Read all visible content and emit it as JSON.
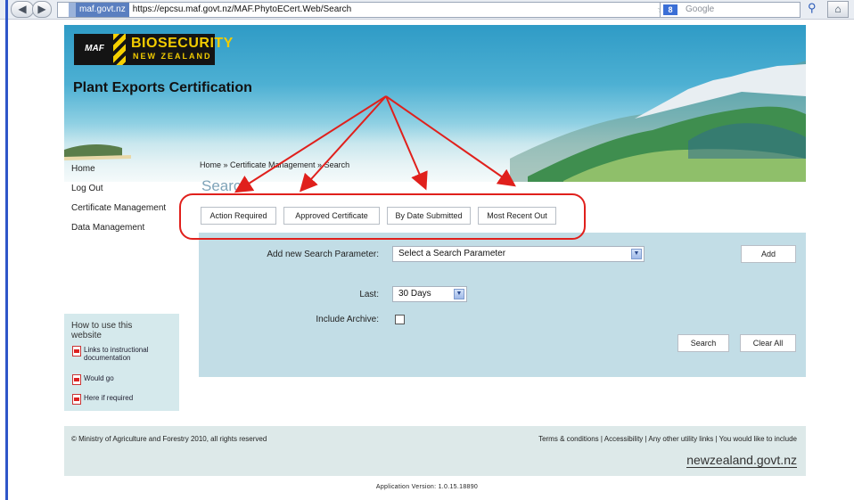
{
  "browser": {
    "site_identity": "maf.govt.nz",
    "url": "https://epcsu.maf.govt.nz/MAF.PhytoECert.Web/Search",
    "search_provider": "Google",
    "accent": "#2e56c9"
  },
  "banner": {
    "logo_top": "BIOSECURITY",
    "logo_bottom": "NEW ZEALAND",
    "logo_maf": "MAF",
    "app_title": "Plant Exports Certification",
    "logo_color": "#f3cc00"
  },
  "nav": {
    "items": [
      {
        "label": "Home"
      },
      {
        "label": "Log Out"
      },
      {
        "label": "Certificate Management"
      },
      {
        "label": "Data Management"
      }
    ]
  },
  "breadcrumb": "Home » Certificate Management » Search",
  "page_title": "Search",
  "quick_buttons": [
    {
      "label": "Action Required"
    },
    {
      "label": "Approved Certificate"
    },
    {
      "label": "By Date Submitted"
    },
    {
      "label": "Most Recent Out"
    }
  ],
  "search_panel": {
    "add_param_label": "Add new Search Parameter:",
    "add_param_value": "Select a Search Parameter",
    "add_button": "Add",
    "last_label": "Last:",
    "last_value": "30 Days",
    "include_archive_label": "Include Archive:",
    "include_archive_checked": false,
    "search_button": "Search",
    "clear_button": "Clear All",
    "background": "#c2dde6"
  },
  "howto": {
    "title": "How to use this website",
    "links": [
      {
        "label": "Links to instructional documentation"
      },
      {
        "label": "Would go"
      },
      {
        "label": "Here if required"
      }
    ]
  },
  "footer": {
    "copyright": "© Ministry of Agriculture and Forestry 2010, all rights reserved",
    "links": "Terms & conditions  |  Accessibility  |  Any other utility links  |  You would like to include",
    "govt_logo": "newzealand.govt.nz",
    "version": "Application Version: 1.0.15.18890"
  },
  "annotation": {
    "color": "#e0201c"
  }
}
